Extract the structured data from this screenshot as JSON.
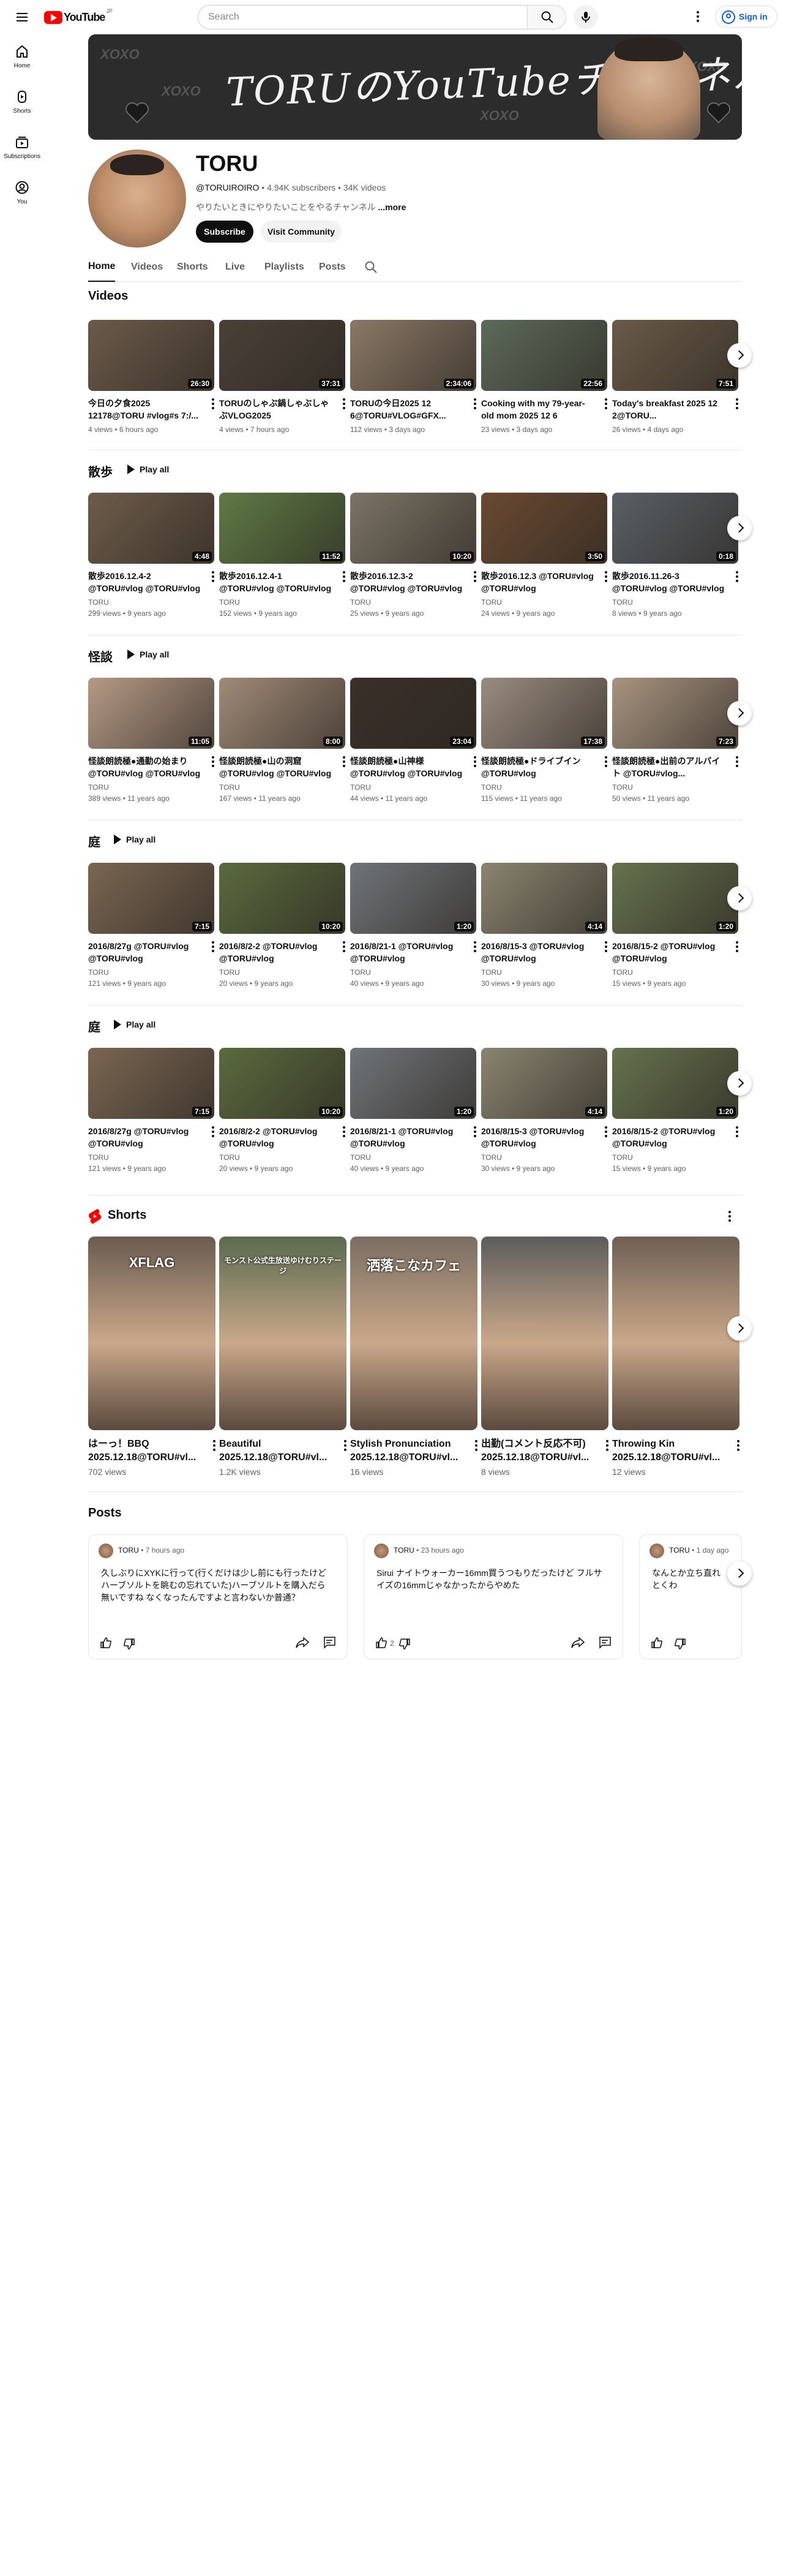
{
  "topbar": {
    "logo_text": "YouTube",
    "logo_sup": "JP",
    "search_placeholder": "Search",
    "signin_label": "Sign in"
  },
  "rail": [
    {
      "label": "Home",
      "icon": "home-icon"
    },
    {
      "label": "Shorts",
      "icon": "shorts-icon"
    },
    {
      "label": "Subscriptions",
      "icon": "subscriptions-icon"
    },
    {
      "label": "You",
      "icon": "you-icon"
    }
  ],
  "banner": {
    "text": "TORUのYouTubeチャンネル",
    "decor": "XOXO"
  },
  "channel": {
    "name": "TORU",
    "handle": "@TORUIROIRO",
    "subscribers": "4.94K subscribers",
    "videos": "34K videos",
    "description": "やりたいときにやりたいことをやるチャンネル",
    "more": "...more",
    "subscribe_label": "Subscribe",
    "community_label": "Visit Community"
  },
  "tabs": [
    "Home",
    "Videos",
    "Shorts",
    "Live",
    "Playlists",
    "Posts"
  ],
  "sections": [
    {
      "title": "Videos",
      "play_all": "",
      "cards": [
        {
          "title": "今日の夕食2025 12178@TORU #vlog#s 7:/...",
          "channel": "",
          "meta": "4 views • 6 hours ago",
          "duration": "26:30",
          "tone": "#6b5a4a"
        },
        {
          "title": "TORUのしゃぶ鍋しゃぶしゃぶVLOG2025 12.10@TORU...",
          "channel": "",
          "meta": "4 views • 7 hours ago",
          "duration": "37:31",
          "tone": "#4a4038"
        },
        {
          "title": "TORUの今日2025 12 6@TORU#VLOG#GFX...",
          "channel": "",
          "meta": "112 views • 3 days ago",
          "duration": "2:34:06",
          "tone": "#8a7866"
        },
        {
          "title": "Cooking with my 79-year-old mom 2025 12 6 @TORU...",
          "channel": "",
          "meta": "23 views • 3 days ago",
          "duration": "22:56",
          "tone": "#5d6a5a"
        },
        {
          "title": "Today's breakfast 2025 12 2@TORU...",
          "channel": "",
          "meta": "26 views • 4 days ago",
          "duration": "7:51",
          "tone": "#6a5a48"
        }
      ]
    },
    {
      "title": "散歩",
      "play_all": "Play all",
      "cards": [
        {
          "title": "散歩2016.12.4-2 @TORU#vlog @TORU#vlog",
          "channel": "TORU",
          "meta": "299 views • 9 years ago",
          "duration": "4:48",
          "tone": "#6e5c4a"
        },
        {
          "title": "散歩2016.12.4-1 @TORU#vlog @TORU#vlog",
          "channel": "TORU",
          "meta": "152 views • 9 years ago",
          "duration": "11:52",
          "tone": "#5f7a45"
        },
        {
          "title": "散歩2016.12.3-2 @TORU#vlog @TORU#vlog",
          "channel": "TORU",
          "meta": "25 views • 9 years ago",
          "duration": "10:20",
          "tone": "#7c7466"
        },
        {
          "title": "散歩2016.12.3 @TORU#vlog @TORU#vlog",
          "channel": "TORU",
          "meta": "24 views • 9 years ago",
          "duration": "3:50",
          "tone": "#6a4a32"
        },
        {
          "title": "散歩2016.11.26-3 @TORU#vlog @TORU#vlog",
          "channel": "TORU",
          "meta": "8 views • 9 years ago",
          "duration": "0:18",
          "tone": "#5a6066"
        }
      ]
    },
    {
      "title": "怪談",
      "play_all": "Play all",
      "cards": [
        {
          "title": "怪談朗読極●通勤の始まり @TORU#vlog @TORU#vlog",
          "channel": "TORU",
          "meta": "389 views • 11 years ago",
          "duration": "11:05",
          "tone": "#b59a86"
        },
        {
          "title": "怪談朗読極●山の洞窟 @TORU#vlog @TORU#vlog",
          "channel": "TORU",
          "meta": "167 views • 11 years ago",
          "duration": "8:00",
          "tone": "#a08a78"
        },
        {
          "title": "怪談朗読極●山神様 @TORU#vlog @TORU#vlog",
          "channel": "TORU",
          "meta": "44 views • 11 years ago",
          "duration": "23:04",
          "tone": "#3a302a"
        },
        {
          "title": "怪談朗読極●ドライブイン @TORU#vlog",
          "channel": "TORU",
          "meta": "115 views • 11 years ago",
          "duration": "17:38",
          "tone": "#9a8c80"
        },
        {
          "title": "怪談朗読極●出前のアルバイト @TORU#vlog...",
          "channel": "TORU",
          "meta": "50 views • 11 years ago",
          "duration": "7:23",
          "tone": "#a89480"
        }
      ]
    },
    {
      "title": "庭",
      "play_all": "Play all",
      "cards": [
        {
          "title": "2016/8/27g @TORU#vlog @TORU#vlog",
          "channel": "TORU",
          "meta": "121 views • 9 years ago",
          "duration": "7:15",
          "tone": "#7a6652"
        },
        {
          "title": "2016/8/2-2 @TORU#vlog @TORU#vlog",
          "channel": "TORU",
          "meta": "20 views • 9 years ago",
          "duration": "10:20",
          "tone": "#5a6a3e"
        },
        {
          "title": "2016/8/21-1 @TORU#vlog @TORU#vlog",
          "channel": "TORU",
          "meta": "40 views • 9 years ago",
          "duration": "1:20",
          "tone": "#707478"
        },
        {
          "title": "2016/8/15-3 @TORU#vlog @TORU#vlog",
          "channel": "TORU",
          "meta": "30 views • 9 years ago",
          "duration": "4:14",
          "tone": "#8a8470"
        },
        {
          "title": "2016/8/15-2 @TORU#vlog @TORU#vlog",
          "channel": "TORU",
          "meta": "15 views • 9 years ago",
          "duration": "1:20",
          "tone": "#66724e"
        }
      ]
    },
    {
      "title": "庭",
      "play_all": "Play all",
      "cards": [
        {
          "title": "2016/8/27g @TORU#vlog @TORU#vlog",
          "channel": "TORU",
          "meta": "121 views • 9 years ago",
          "duration": "7:15",
          "tone": "#7a6652"
        },
        {
          "title": "2016/8/2-2 @TORU#vlog @TORU#vlog",
          "channel": "TORU",
          "meta": "20 views • 9 years ago",
          "duration": "10:20",
          "tone": "#5a6a3e"
        },
        {
          "title": "2016/8/21-1 @TORU#vlog @TORU#vlog",
          "channel": "TORU",
          "meta": "40 views • 9 years ago",
          "duration": "1:20",
          "tone": "#707478"
        },
        {
          "title": "2016/8/15-3 @TORU#vlog @TORU#vlog",
          "channel": "TORU",
          "meta": "30 views • 9 years ago",
          "duration": "4:14",
          "tone": "#8a8470"
        },
        {
          "title": "2016/8/15-2 @TORU#vlog @TORU#vlog",
          "channel": "TORU",
          "meta": "15 views • 9 years ago",
          "duration": "1:20",
          "tone": "#66724e"
        }
      ]
    }
  ],
  "shorts": {
    "title": "Shorts",
    "items": [
      {
        "title": "はーっ！BBQ 2025.12.18@TORU#vl...",
        "views": "702 views",
        "overlay": "XFLAG",
        "tone": "#6a5c50"
      },
      {
        "title": "Beautiful 2025.12.18@TORU#vl...",
        "views": "1.2K views",
        "overlay": "モンスト公式生放送ゆけむりステージ",
        "tone": "#5a6a4e"
      },
      {
        "title": "Stylish Pronunciation 2025.12.18@TORU#vl...",
        "views": "16 views",
        "overlay": "洒落こなカフェ",
        "tone": "#7a6e62"
      },
      {
        "title": "出勤(コメント反応不可) 2025.12.18@TORU#vl...",
        "views": "8 views",
        "overlay": "",
        "tone": "#5c5c5c"
      },
      {
        "title": "Throwing Kin 2025.12.18@TORU#vl...",
        "views": "12 views",
        "overlay": "",
        "tone": "#6e6054"
      }
    ]
  },
  "posts": {
    "title": "Posts",
    "items": [
      {
        "author": "TORU",
        "time": "7 hours ago",
        "text": "久しぶりにXYKに行って(行くだけは少し前にも行ったけどハーブソルトを眺むの忘れていた)ハーブソルトを購入だら 無いですね なくなったんですよと言わないか普通？",
        "likes": ""
      },
      {
        "author": "TORU",
        "time": "23 hours ago",
        "text": "Sirui ナイトウォーカー16mm買うつもりだったけど フルサイズの16mmじゃなかったからやめた",
        "likes": "2"
      },
      {
        "author": "TORU",
        "time": "1 day ago",
        "text": "なんとか立ち直れとくわ",
        "likes": ""
      }
    ]
  }
}
